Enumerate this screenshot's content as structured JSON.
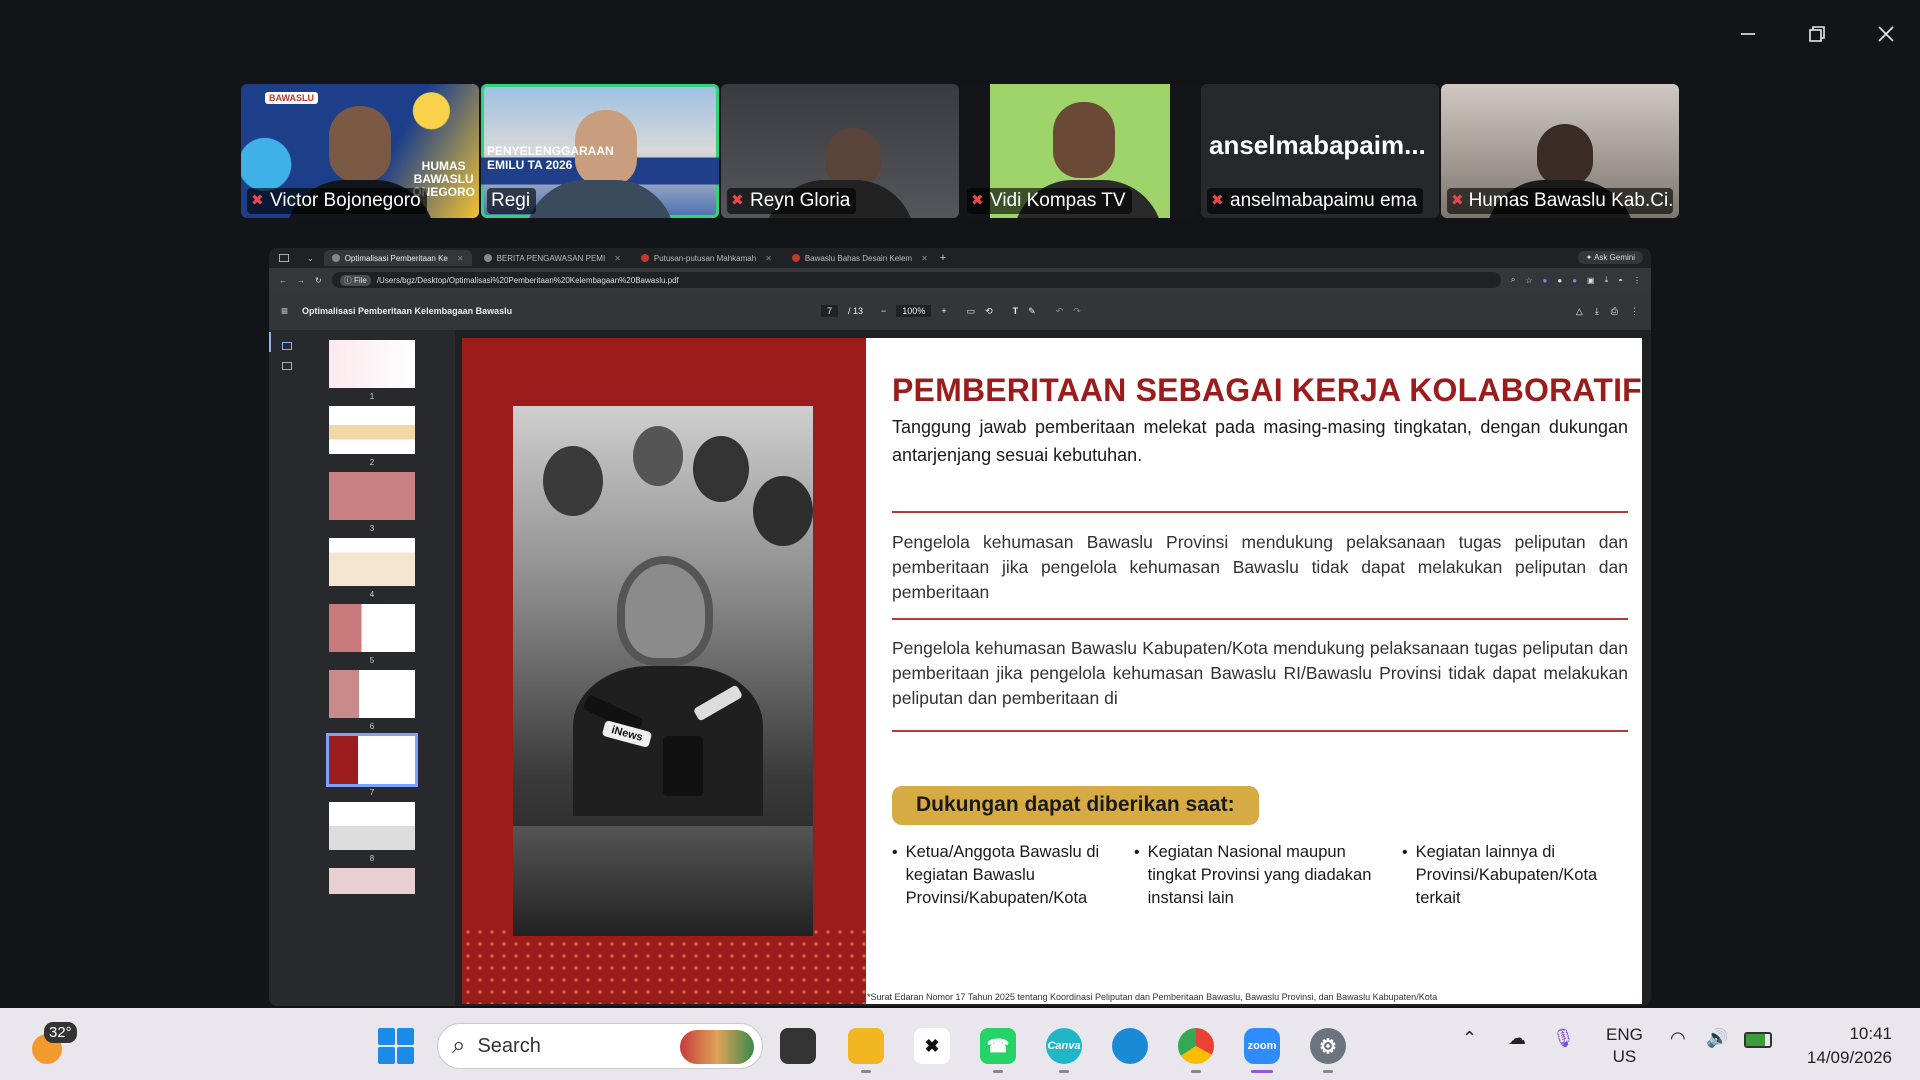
{
  "window": {
    "minimize_icon": "minimize-icon",
    "restore_icon": "restore-icon",
    "close_icon": "close-icon"
  },
  "participants": [
    {
      "name": "Victor Bojonegoro",
      "muted": true,
      "bg_text_1": "HUMAS",
      "bg_text_2": "BAWASLU",
      "bg_text_3": "ONEGORO",
      "logo_text": "BAWASLU"
    },
    {
      "name": "Regi",
      "muted": false,
      "active": true,
      "bg_text_1": "PENYELENGGARAAN",
      "bg_text_2": "EMILU TA 2026"
    },
    {
      "name": "Reyn Gloria",
      "muted": true
    },
    {
      "name": "Vidi Kompas TV",
      "muted": true
    },
    {
      "name": "anselmabapaimu ema",
      "muted": true,
      "big_label": "anselmabapaim..."
    },
    {
      "name": "Humas Bawaslu Kab.Ci...",
      "muted": true
    }
  ],
  "browser": {
    "tabs": [
      {
        "label": "Optimalisasi Pemberitaan Ke",
        "active": true
      },
      {
        "label": "BERITA PENGAWASAN PEMI"
      },
      {
        "label": "Putusan-putusan Mahkamah"
      },
      {
        "label": "Bawaslu Bahas Desain Kelem"
      }
    ],
    "ask_label": "Ask Gemini",
    "url_prefix": "File",
    "url": "/Users/bgz/Desktop/Optimalisasi%20Pemberitaan%20Kelembagaan%20Bawaslu.pdf"
  },
  "pdf": {
    "title": "Optimalisasi Pemberitaan Kelembagaan Bawaslu",
    "page_current": "7",
    "page_total": "/ 13",
    "zoom": "100%",
    "thumbnails": [
      "1",
      "2",
      "3",
      "4",
      "5",
      "6",
      "7",
      "8"
    ],
    "selected_page": 7
  },
  "slide": {
    "title": "PEMBERITAAN SEBAGAI KERJA KOLABORATIF",
    "subtitle": "Tanggung jawab pemberitaan melekat pada masing-masing tingkatan, dengan dukungan antarjenjang sesuai kebutuhan.",
    "para1": "Pengelola kehumasan Bawaslu Provinsi mendukung pelaksanaan tugas peliputan dan pemberitaan jika pengelola kehumasan Bawaslu tidak dapat melakukan peliputan dan pemberitaan",
    "para2": "Pengelola kehumasan Bawaslu Kabupaten/Kota mendukung pelaksanaan tugas peliputan dan pemberitaan jika pengelola kehumasan Bawaslu RI/Bawaslu Provinsi tidak dapat melakukan peliputan dan pemberitaan di",
    "support_heading": "Dukungan dapat diberikan saat:",
    "bullets": [
      "Ketua/Anggota Bawaslu di kegiatan Bawaslu Provinsi/Kabupaten/Kota",
      "Kegiatan Nasional maupun tingkat Provinsi yang diadakan instansi lain",
      "Kegiatan lainnya di Provinsi/Kabupaten/Kota terkait"
    ],
    "footnote": "*Surat Edaran Nomor 17 Tahun 2025 tentang Koordinasi Peliputan dan Pemberitaan Bawaslu, Bawaslu Provinsi, dan Bawaslu Kabupaten/Kota",
    "photo_mic_label": "iNews"
  },
  "taskbar": {
    "temperature": "32°",
    "search_placeholder": "Search",
    "apps": [
      "file-explorer",
      "capcut",
      "whatsapp",
      "canva",
      "edge",
      "chrome",
      "zoom",
      "settings"
    ],
    "canva_label": "Canva",
    "zoom_label": "zoom",
    "language": "ENG",
    "region": "US",
    "time": "10:41",
    "date": "14/09/2026"
  },
  "colors": {
    "slide_accent": "#9c1c1c",
    "support_pill": "#d6ab44",
    "active_speaker": "#2fd37a",
    "muted_icon": "#e5484d"
  }
}
